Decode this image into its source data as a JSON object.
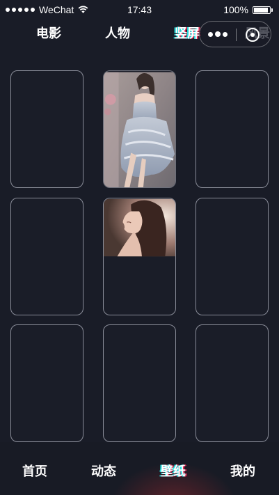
{
  "status_bar": {
    "carrier": "WeChat",
    "time": "17:43",
    "battery_percent": "100%",
    "battery_level": 1.0
  },
  "top_tabs": [
    {
      "label": "电影",
      "active": false
    },
    {
      "label": "人物",
      "active": false
    },
    {
      "label": "竖屏",
      "active": true
    },
    {
      "label": "风景",
      "active": false
    }
  ],
  "capsule": {
    "more_icon": "more-dots-icon",
    "close_icon": "target-close-icon"
  },
  "grid": {
    "rows": 3,
    "columns": 3,
    "images": [
      {
        "slot": 2,
        "subject": "woman-in-grey-feather-gown"
      },
      {
        "slot": 5,
        "subject": "woman-profile-portrait"
      }
    ]
  },
  "bottom_nav": [
    {
      "label": "首页",
      "active": false
    },
    {
      "label": "动态",
      "active": false
    },
    {
      "label": "壁纸",
      "active": true
    },
    {
      "label": "我的",
      "active": false
    }
  ],
  "colors": {
    "background": "#191c27",
    "card_border": "#8a8d99",
    "active_cyan": "#1fe0e0",
    "active_red": "#e02a55"
  }
}
